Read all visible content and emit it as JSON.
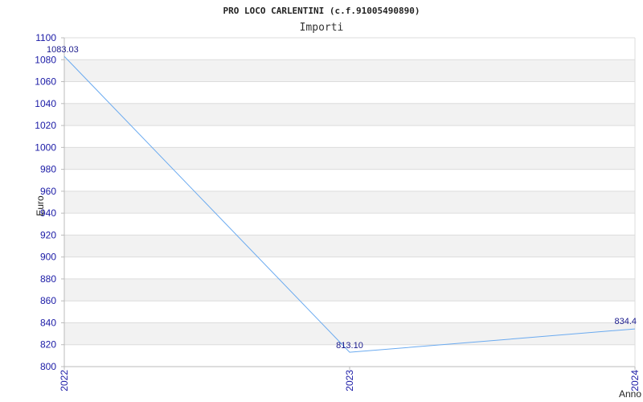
{
  "colors": {
    "series_line": "#6aaaf0",
    "band_fill": "#f2f2f2",
    "grid_line": "#dcdcdc",
    "axis_line": "#bbbbbb",
    "tick_text": "#1a1aa6"
  },
  "chart_data": {
    "type": "line",
    "title": "PRO LOCO CARLENTINI (c.f.91005490890)",
    "subtitle": "Importi",
    "xlabel": "Anno",
    "ylabel": "Euro",
    "categories": [
      "2022",
      "2023",
      "2024"
    ],
    "series": [
      {
        "values": [
          1083.03,
          813.1,
          834.4
        ],
        "labels": [
          "1083.03",
          "813.10",
          "834.4"
        ]
      }
    ],
    "ylim": [
      800,
      1100
    ],
    "ystep": 20,
    "grid": true
  }
}
